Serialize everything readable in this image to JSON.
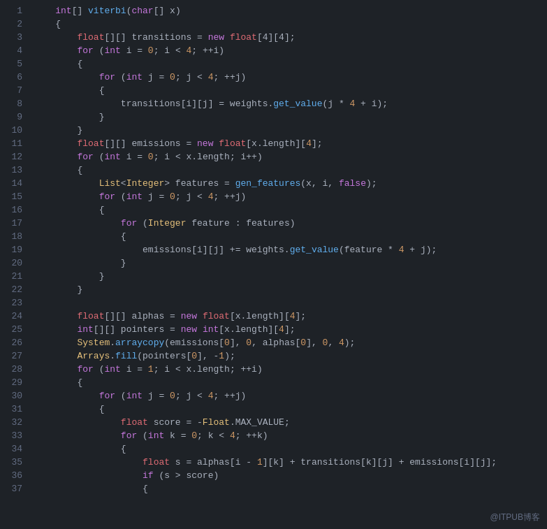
{
  "watermark": "@ITPUB博客",
  "lines": [
    {
      "n": 1,
      "tokens": [
        {
          "t": "    ",
          "c": ""
        },
        {
          "t": "int",
          "c": "kw"
        },
        {
          "t": "[] ",
          "c": "plain"
        },
        {
          "t": "viterbi",
          "c": "fn"
        },
        {
          "t": "(",
          "c": "plain"
        },
        {
          "t": "char",
          "c": "kw"
        },
        {
          "t": "[] x)",
          "c": "plain"
        }
      ]
    },
    {
      "n": 2,
      "tokens": [
        {
          "t": "    ",
          "c": ""
        },
        {
          "t": "{",
          "c": "plain"
        }
      ]
    },
    {
      "n": 3,
      "tokens": [
        {
          "t": "        ",
          "c": ""
        },
        {
          "t": "float",
          "c": "kw2"
        },
        {
          "t": "[][] transitions = ",
          "c": "plain"
        },
        {
          "t": "new",
          "c": "kw"
        },
        {
          "t": " ",
          "c": "plain"
        },
        {
          "t": "float",
          "c": "kw2"
        },
        {
          "t": "[4][4];",
          "c": "plain"
        }
      ]
    },
    {
      "n": 4,
      "tokens": [
        {
          "t": "        ",
          "c": ""
        },
        {
          "t": "for",
          "c": "kw"
        },
        {
          "t": " (",
          "c": "plain"
        },
        {
          "t": "int",
          "c": "kw"
        },
        {
          "t": " i = ",
          "c": "plain"
        },
        {
          "t": "0",
          "c": "num"
        },
        {
          "t": "; i < ",
          "c": "plain"
        },
        {
          "t": "4",
          "c": "num"
        },
        {
          "t": "; ++i)",
          "c": "plain"
        }
      ]
    },
    {
      "n": 5,
      "tokens": [
        {
          "t": "        ",
          "c": ""
        },
        {
          "t": "{",
          "c": "plain"
        }
      ]
    },
    {
      "n": 6,
      "tokens": [
        {
          "t": "            ",
          "c": ""
        },
        {
          "t": "for",
          "c": "kw"
        },
        {
          "t": " (",
          "c": "plain"
        },
        {
          "t": "int",
          "c": "kw"
        },
        {
          "t": " j = ",
          "c": "plain"
        },
        {
          "t": "0",
          "c": "num"
        },
        {
          "t": "; j < ",
          "c": "plain"
        },
        {
          "t": "4",
          "c": "num"
        },
        {
          "t": "; ++j)",
          "c": "plain"
        }
      ]
    },
    {
      "n": 7,
      "tokens": [
        {
          "t": "            ",
          "c": ""
        },
        {
          "t": "{",
          "c": "plain"
        }
      ]
    },
    {
      "n": 8,
      "tokens": [
        {
          "t": "                ",
          "c": ""
        },
        {
          "t": "transitions[i][j] = weights.",
          "c": "plain"
        },
        {
          "t": "get_value",
          "c": "fn"
        },
        {
          "t": "(j * ",
          "c": "plain"
        },
        {
          "t": "4",
          "c": "num"
        },
        {
          "t": " + i);",
          "c": "plain"
        }
      ]
    },
    {
      "n": 9,
      "tokens": [
        {
          "t": "            ",
          "c": ""
        },
        {
          "t": "}",
          "c": "plain"
        }
      ]
    },
    {
      "n": 10,
      "tokens": [
        {
          "t": "        ",
          "c": ""
        },
        {
          "t": "}",
          "c": "plain"
        }
      ]
    },
    {
      "n": 11,
      "tokens": [
        {
          "t": "        ",
          "c": ""
        },
        {
          "t": "float",
          "c": "kw2"
        },
        {
          "t": "[][] emissions = ",
          "c": "plain"
        },
        {
          "t": "new",
          "c": "kw"
        },
        {
          "t": " ",
          "c": "plain"
        },
        {
          "t": "float",
          "c": "kw2"
        },
        {
          "t": "[x.length][",
          "c": "plain"
        },
        {
          "t": "4",
          "c": "num"
        },
        {
          "t": "];",
          "c": "plain"
        }
      ]
    },
    {
      "n": 12,
      "tokens": [
        {
          "t": "        ",
          "c": ""
        },
        {
          "t": "for",
          "c": "kw"
        },
        {
          "t": " (",
          "c": "plain"
        },
        {
          "t": "int",
          "c": "kw"
        },
        {
          "t": " i = ",
          "c": "plain"
        },
        {
          "t": "0",
          "c": "num"
        },
        {
          "t": "; i < x.length; i++)",
          "c": "plain"
        }
      ]
    },
    {
      "n": 13,
      "tokens": [
        {
          "t": "        ",
          "c": ""
        },
        {
          "t": "{",
          "c": "plain"
        }
      ]
    },
    {
      "n": 14,
      "tokens": [
        {
          "t": "            ",
          "c": ""
        },
        {
          "t": "List",
          "c": "cls"
        },
        {
          "t": "<",
          "c": "plain"
        },
        {
          "t": "Integer",
          "c": "cls"
        },
        {
          "t": "> features = ",
          "c": "plain"
        },
        {
          "t": "gen_features",
          "c": "fn"
        },
        {
          "t": "(x, i, ",
          "c": "plain"
        },
        {
          "t": "false",
          "c": "kw"
        },
        {
          "t": ");",
          "c": "plain"
        }
      ]
    },
    {
      "n": 15,
      "tokens": [
        {
          "t": "            ",
          "c": ""
        },
        {
          "t": "for",
          "c": "kw"
        },
        {
          "t": " (",
          "c": "plain"
        },
        {
          "t": "int",
          "c": "kw"
        },
        {
          "t": " j = ",
          "c": "plain"
        },
        {
          "t": "0",
          "c": "num"
        },
        {
          "t": "; j < ",
          "c": "plain"
        },
        {
          "t": "4",
          "c": "num"
        },
        {
          "t": "; ++j)",
          "c": "plain"
        }
      ]
    },
    {
      "n": 16,
      "tokens": [
        {
          "t": "            ",
          "c": ""
        },
        {
          "t": "{",
          "c": "plain"
        }
      ]
    },
    {
      "n": 17,
      "tokens": [
        {
          "t": "                ",
          "c": ""
        },
        {
          "t": "for",
          "c": "kw"
        },
        {
          "t": " (",
          "c": "plain"
        },
        {
          "t": "Integer",
          "c": "cls"
        },
        {
          "t": " feature : features)",
          "c": "plain"
        }
      ]
    },
    {
      "n": 18,
      "tokens": [
        {
          "t": "                ",
          "c": ""
        },
        {
          "t": "{",
          "c": "plain"
        }
      ]
    },
    {
      "n": 19,
      "tokens": [
        {
          "t": "                    ",
          "c": ""
        },
        {
          "t": "emissions[i][j] += weights.",
          "c": "plain"
        },
        {
          "t": "get_value",
          "c": "fn"
        },
        {
          "t": "(feature * ",
          "c": "plain"
        },
        {
          "t": "4",
          "c": "num"
        },
        {
          "t": " + j);",
          "c": "plain"
        }
      ]
    },
    {
      "n": 20,
      "tokens": [
        {
          "t": "                ",
          "c": ""
        },
        {
          "t": "}",
          "c": "plain"
        }
      ]
    },
    {
      "n": 21,
      "tokens": [
        {
          "t": "            ",
          "c": ""
        },
        {
          "t": "}",
          "c": "plain"
        }
      ]
    },
    {
      "n": 22,
      "tokens": [
        {
          "t": "        ",
          "c": ""
        },
        {
          "t": "}",
          "c": "plain"
        }
      ]
    },
    {
      "n": 23,
      "tokens": [
        {
          "t": "",
          "c": ""
        }
      ]
    },
    {
      "n": 24,
      "tokens": [
        {
          "t": "        ",
          "c": ""
        },
        {
          "t": "float",
          "c": "kw2"
        },
        {
          "t": "[][] alphas = ",
          "c": "plain"
        },
        {
          "t": "new",
          "c": "kw"
        },
        {
          "t": " ",
          "c": "plain"
        },
        {
          "t": "float",
          "c": "kw2"
        },
        {
          "t": "[x.length][",
          "c": "plain"
        },
        {
          "t": "4",
          "c": "num"
        },
        {
          "t": "];",
          "c": "plain"
        }
      ]
    },
    {
      "n": 25,
      "tokens": [
        {
          "t": "        ",
          "c": ""
        },
        {
          "t": "int",
          "c": "kw"
        },
        {
          "t": "[][] pointers = ",
          "c": "plain"
        },
        {
          "t": "new",
          "c": "kw"
        },
        {
          "t": " ",
          "c": "plain"
        },
        {
          "t": "int",
          "c": "kw"
        },
        {
          "t": "[x.length][",
          "c": "plain"
        },
        {
          "t": "4",
          "c": "num"
        },
        {
          "t": "];",
          "c": "plain"
        }
      ]
    },
    {
      "n": 26,
      "tokens": [
        {
          "t": "        ",
          "c": ""
        },
        {
          "t": "System",
          "c": "cls"
        },
        {
          "t": ".",
          "c": "plain"
        },
        {
          "t": "arraycopy",
          "c": "fn"
        },
        {
          "t": "(emissions[",
          "c": "plain"
        },
        {
          "t": "0",
          "c": "num"
        },
        {
          "t": "], ",
          "c": "plain"
        },
        {
          "t": "0",
          "c": "num"
        },
        {
          "t": ", alphas[",
          "c": "plain"
        },
        {
          "t": "0",
          "c": "num"
        },
        {
          "t": "], ",
          "c": "plain"
        },
        {
          "t": "0",
          "c": "num"
        },
        {
          "t": ", ",
          "c": "plain"
        },
        {
          "t": "4",
          "c": "num"
        },
        {
          "t": ");",
          "c": "plain"
        }
      ]
    },
    {
      "n": 27,
      "tokens": [
        {
          "t": "        ",
          "c": ""
        },
        {
          "t": "Arrays",
          "c": "cls"
        },
        {
          "t": ".",
          "c": "plain"
        },
        {
          "t": "fill",
          "c": "fn"
        },
        {
          "t": "(pointers[",
          "c": "plain"
        },
        {
          "t": "0",
          "c": "num"
        },
        {
          "t": "], -",
          "c": "plain"
        },
        {
          "t": "1",
          "c": "num"
        },
        {
          "t": ");",
          "c": "plain"
        }
      ]
    },
    {
      "n": 28,
      "tokens": [
        {
          "t": "        ",
          "c": ""
        },
        {
          "t": "for",
          "c": "kw"
        },
        {
          "t": " (",
          "c": "plain"
        },
        {
          "t": "int",
          "c": "kw"
        },
        {
          "t": " i = ",
          "c": "plain"
        },
        {
          "t": "1",
          "c": "num"
        },
        {
          "t": "; i < x.length; ++i)",
          "c": "plain"
        }
      ]
    },
    {
      "n": 29,
      "tokens": [
        {
          "t": "        ",
          "c": ""
        },
        {
          "t": "{",
          "c": "plain"
        }
      ]
    },
    {
      "n": 30,
      "tokens": [
        {
          "t": "            ",
          "c": ""
        },
        {
          "t": "for",
          "c": "kw"
        },
        {
          "t": " (",
          "c": "plain"
        },
        {
          "t": "int",
          "c": "kw"
        },
        {
          "t": " j = ",
          "c": "plain"
        },
        {
          "t": "0",
          "c": "num"
        },
        {
          "t": "; j < ",
          "c": "plain"
        },
        {
          "t": "4",
          "c": "num"
        },
        {
          "t": "; ++j)",
          "c": "plain"
        }
      ]
    },
    {
      "n": 31,
      "tokens": [
        {
          "t": "            ",
          "c": ""
        },
        {
          "t": "{",
          "c": "plain"
        }
      ]
    },
    {
      "n": 32,
      "tokens": [
        {
          "t": "                ",
          "c": ""
        },
        {
          "t": "float",
          "c": "kw2"
        },
        {
          "t": " score = -",
          "c": "plain"
        },
        {
          "t": "Float",
          "c": "cls"
        },
        {
          "t": ".MAX_VALUE;",
          "c": "plain"
        }
      ]
    },
    {
      "n": 33,
      "tokens": [
        {
          "t": "                ",
          "c": ""
        },
        {
          "t": "for",
          "c": "kw"
        },
        {
          "t": " (",
          "c": "plain"
        },
        {
          "t": "int",
          "c": "kw"
        },
        {
          "t": " k = ",
          "c": "plain"
        },
        {
          "t": "0",
          "c": "num"
        },
        {
          "t": "; k < ",
          "c": "plain"
        },
        {
          "t": "4",
          "c": "num"
        },
        {
          "t": "; ++k)",
          "c": "plain"
        }
      ]
    },
    {
      "n": 34,
      "tokens": [
        {
          "t": "                ",
          "c": ""
        },
        {
          "t": "{",
          "c": "plain"
        }
      ]
    },
    {
      "n": 35,
      "tokens": [
        {
          "t": "                    ",
          "c": ""
        },
        {
          "t": "float",
          "c": "kw2"
        },
        {
          "t": " s = alphas[i - ",
          "c": "plain"
        },
        {
          "t": "1",
          "c": "num"
        },
        {
          "t": "][k] + transitions[k][j] + emissions[i][j];",
          "c": "plain"
        }
      ]
    },
    {
      "n": 36,
      "tokens": [
        {
          "t": "                    ",
          "c": ""
        },
        {
          "t": "if",
          "c": "kw"
        },
        {
          "t": " (s > score)",
          "c": "plain"
        }
      ]
    },
    {
      "n": 37,
      "tokens": [
        {
          "t": "                    ",
          "c": ""
        },
        {
          "t": "{",
          "c": "plain"
        }
      ]
    }
  ]
}
